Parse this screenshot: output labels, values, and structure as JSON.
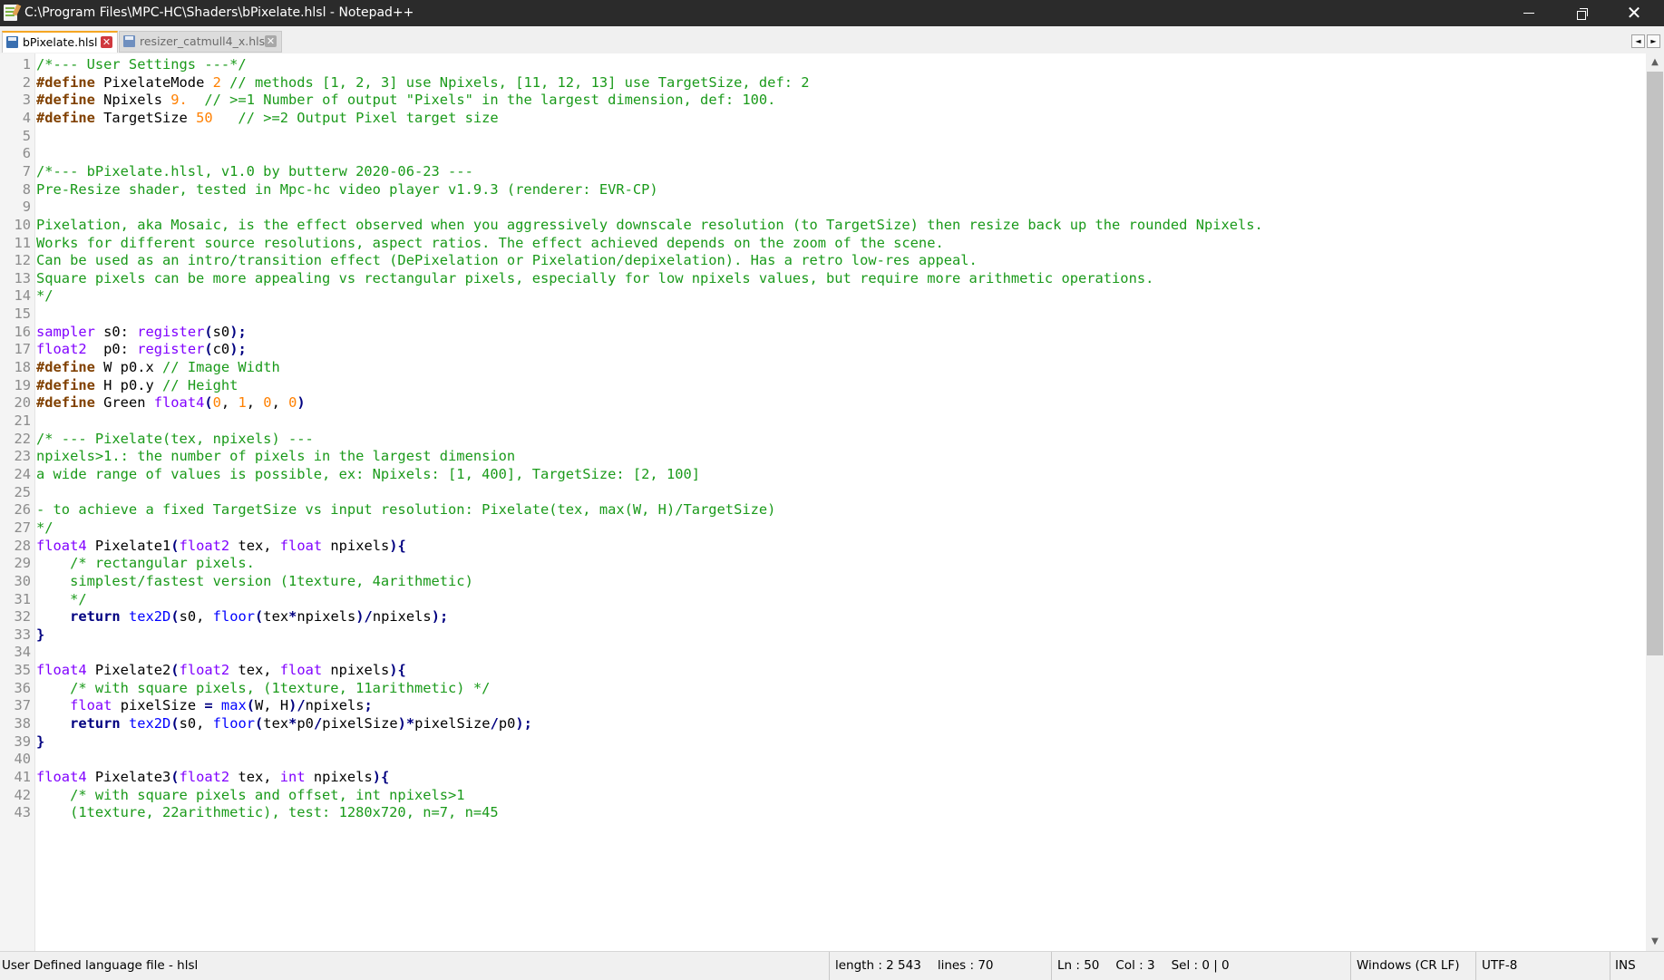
{
  "window": {
    "title": "C:\\Program Files\\MPC-HC\\Shaders\\bPixelate.hlsl - Notepad++",
    "controls": {
      "minimize_icon": "minimize-icon",
      "maximize_icon": "restore-icon",
      "close_icon": "close-icon"
    }
  },
  "tabs": [
    {
      "label": "bPixelate.hlsl",
      "active": true,
      "icon": "save-icon"
    },
    {
      "label": "resizer_catmull4_x.hlsl",
      "active": false,
      "icon": "save-icon"
    }
  ],
  "tab_scroll": {
    "left": "◄",
    "right": "►"
  },
  "colors": {
    "comment": "#1a9a1a",
    "preprocessor": "#804000",
    "number": "#ff8000",
    "type": "#8000ff",
    "keyword": "#000080",
    "function": "#0000ff",
    "active_tab_accent": "#f5a623",
    "titlebar": "#2b2b2b"
  },
  "editor": {
    "lines": [
      {
        "n": "1",
        "tokens": [
          [
            "cmt",
            "/*--- User Settings ---*/"
          ]
        ]
      },
      {
        "n": "2",
        "tokens": [
          [
            "pre",
            "#define"
          ],
          [
            "plain",
            " PixelateMode "
          ],
          [
            "num",
            "2"
          ],
          [
            "cmt",
            " // methods [1, 2, 3] use Npixels, [11, 12, 13] use TargetSize, def: 2"
          ]
        ]
      },
      {
        "n": "3",
        "tokens": [
          [
            "pre",
            "#define"
          ],
          [
            "plain",
            " Npixels "
          ],
          [
            "num",
            "9."
          ],
          [
            "cmt",
            "  // >=1 Number of output \"Pixels\" in the largest dimension, def: 100."
          ]
        ]
      },
      {
        "n": "4",
        "tokens": [
          [
            "pre",
            "#define"
          ],
          [
            "plain",
            " TargetSize "
          ],
          [
            "num",
            "50"
          ],
          [
            "cmt",
            "   // >=2 Output Pixel target size"
          ]
        ]
      },
      {
        "n": "5",
        "tokens": []
      },
      {
        "n": "6",
        "tokens": []
      },
      {
        "n": "7",
        "tokens": [
          [
            "cmt",
            "/*--- bPixelate.hlsl, v1.0 by butterw 2020-06-23 ---"
          ]
        ]
      },
      {
        "n": "8",
        "tokens": [
          [
            "cmt",
            "Pre-Resize shader, tested in Mpc-hc video player v1.9.3 (renderer: EVR-CP)"
          ]
        ]
      },
      {
        "n": "9",
        "tokens": []
      },
      {
        "n": "10",
        "tokens": [
          [
            "cmt",
            "Pixelation, aka Mosaic, is the effect observed when you aggressively downscale resolution (to TargetSize) then resize back up the rounded Npixels."
          ]
        ]
      },
      {
        "n": "11",
        "tokens": [
          [
            "cmt",
            "Works for different source resolutions, aspect ratios. The effect achieved depends on the zoom of the scene."
          ]
        ]
      },
      {
        "n": "12",
        "tokens": [
          [
            "cmt",
            "Can be used as an intro/transition effect (DePixelation or Pixelation/depixelation). Has a retro low-res appeal."
          ]
        ]
      },
      {
        "n": "13",
        "tokens": [
          [
            "cmt",
            "Square pixels can be more appealing vs rectangular pixels, especially for low npixels values, but require more arithmetic operations."
          ]
        ]
      },
      {
        "n": "14",
        "tokens": [
          [
            "cmt",
            "*/"
          ]
        ]
      },
      {
        "n": "15",
        "tokens": []
      },
      {
        "n": "16",
        "tokens": [
          [
            "type",
            "sampler"
          ],
          [
            "plain",
            " s0: "
          ],
          [
            "type",
            "register"
          ],
          [
            "op",
            "("
          ],
          [
            "plain",
            "s0"
          ],
          [
            "op",
            ");"
          ]
        ]
      },
      {
        "n": "17",
        "tokens": [
          [
            "type",
            "float2"
          ],
          [
            "plain",
            "  p0: "
          ],
          [
            "type",
            "register"
          ],
          [
            "op",
            "("
          ],
          [
            "plain",
            "c0"
          ],
          [
            "op",
            ");"
          ]
        ]
      },
      {
        "n": "18",
        "tokens": [
          [
            "pre",
            "#define"
          ],
          [
            "plain",
            " W p0.x "
          ],
          [
            "cmt",
            "// Image Width"
          ]
        ]
      },
      {
        "n": "19",
        "tokens": [
          [
            "pre",
            "#define"
          ],
          [
            "plain",
            " H p0.y "
          ],
          [
            "cmt",
            "// Height"
          ]
        ]
      },
      {
        "n": "20",
        "tokens": [
          [
            "pre",
            "#define"
          ],
          [
            "plain",
            " Green "
          ],
          [
            "type",
            "float4"
          ],
          [
            "op",
            "("
          ],
          [
            "num",
            "0"
          ],
          [
            "plain",
            ", "
          ],
          [
            "num",
            "1"
          ],
          [
            "plain",
            ", "
          ],
          [
            "num",
            "0"
          ],
          [
            "plain",
            ", "
          ],
          [
            "num",
            "0"
          ],
          [
            "op",
            ")"
          ]
        ]
      },
      {
        "n": "21",
        "tokens": []
      },
      {
        "n": "22",
        "tokens": [
          [
            "cmt",
            "/* --- Pixelate(tex, npixels) ---"
          ]
        ]
      },
      {
        "n": "23",
        "tokens": [
          [
            "cmt",
            "npixels>1.: the number of pixels in the largest dimension"
          ]
        ]
      },
      {
        "n": "24",
        "tokens": [
          [
            "cmt",
            "a wide range of values is possible, ex: Npixels: [1, 400], TargetSize: [2, 100]"
          ]
        ]
      },
      {
        "n": "25",
        "tokens": []
      },
      {
        "n": "26",
        "tokens": [
          [
            "cmt",
            "- to achieve a fixed TargetSize vs input resolution: Pixelate(tex, max(W, H)/TargetSize)"
          ]
        ]
      },
      {
        "n": "27",
        "tokens": [
          [
            "cmt",
            "*/"
          ]
        ]
      },
      {
        "n": "28",
        "tokens": [
          [
            "type",
            "float4"
          ],
          [
            "plain",
            " Pixelate1"
          ],
          [
            "op",
            "("
          ],
          [
            "type",
            "float2"
          ],
          [
            "plain",
            " tex, "
          ],
          [
            "type",
            "float"
          ],
          [
            "plain",
            " npixels"
          ],
          [
            "op",
            "){"
          ]
        ]
      },
      {
        "n": "29",
        "tokens": [
          [
            "cmt",
            "    /* rectangular pixels."
          ]
        ]
      },
      {
        "n": "30",
        "tokens": [
          [
            "cmt",
            "    simplest/fastest version (1texture, 4arithmetic)"
          ]
        ]
      },
      {
        "n": "31",
        "tokens": [
          [
            "cmt",
            "    */"
          ]
        ]
      },
      {
        "n": "32",
        "tokens": [
          [
            "plain",
            "    "
          ],
          [
            "kw",
            "return"
          ],
          [
            "plain",
            " "
          ],
          [
            "fn",
            "tex2D"
          ],
          [
            "op",
            "("
          ],
          [
            "plain",
            "s0, "
          ],
          [
            "fn",
            "floor"
          ],
          [
            "op",
            "("
          ],
          [
            "plain",
            "tex"
          ],
          [
            "op",
            "*"
          ],
          [
            "plain",
            "npixels"
          ],
          [
            "op",
            ")/"
          ],
          [
            "plain",
            "npixels"
          ],
          [
            "op",
            ");"
          ]
        ]
      },
      {
        "n": "33",
        "tokens": [
          [
            "op",
            "}"
          ]
        ]
      },
      {
        "n": "34",
        "tokens": []
      },
      {
        "n": "35",
        "tokens": [
          [
            "type",
            "float4"
          ],
          [
            "plain",
            " Pixelate2"
          ],
          [
            "op",
            "("
          ],
          [
            "type",
            "float2"
          ],
          [
            "plain",
            " tex, "
          ],
          [
            "type",
            "float"
          ],
          [
            "plain",
            " npixels"
          ],
          [
            "op",
            "){"
          ]
        ]
      },
      {
        "n": "36",
        "tokens": [
          [
            "cmt",
            "    /* with square pixels, (1texture, 11arithmetic) */"
          ]
        ]
      },
      {
        "n": "37",
        "tokens": [
          [
            "plain",
            "    "
          ],
          [
            "type",
            "float"
          ],
          [
            "plain",
            " pixelSize "
          ],
          [
            "op",
            "="
          ],
          [
            "plain",
            " "
          ],
          [
            "fn",
            "max"
          ],
          [
            "op",
            "("
          ],
          [
            "plain",
            "W, H"
          ],
          [
            "op",
            ")/"
          ],
          [
            "plain",
            "npixels"
          ],
          [
            "op",
            ";"
          ]
        ]
      },
      {
        "n": "38",
        "tokens": [
          [
            "plain",
            "    "
          ],
          [
            "kw",
            "return"
          ],
          [
            "plain",
            " "
          ],
          [
            "fn",
            "tex2D"
          ],
          [
            "op",
            "("
          ],
          [
            "plain",
            "s0, "
          ],
          [
            "fn",
            "floor"
          ],
          [
            "op",
            "("
          ],
          [
            "plain",
            "tex"
          ],
          [
            "op",
            "*"
          ],
          [
            "plain",
            "p0"
          ],
          [
            "op",
            "/"
          ],
          [
            "plain",
            "pixelSize"
          ],
          [
            "op",
            ")*"
          ],
          [
            "plain",
            "pixelSize"
          ],
          [
            "op",
            "/"
          ],
          [
            "plain",
            "p0"
          ],
          [
            "op",
            ");"
          ]
        ]
      },
      {
        "n": "39",
        "tokens": [
          [
            "op",
            "}"
          ]
        ]
      },
      {
        "n": "40",
        "tokens": []
      },
      {
        "n": "41",
        "tokens": [
          [
            "type",
            "float4"
          ],
          [
            "plain",
            " Pixelate3"
          ],
          [
            "op",
            "("
          ],
          [
            "type",
            "float2"
          ],
          [
            "plain",
            " tex, "
          ],
          [
            "type",
            "int"
          ],
          [
            "plain",
            " npixels"
          ],
          [
            "op",
            "){"
          ]
        ]
      },
      {
        "n": "42",
        "tokens": [
          [
            "cmt",
            "    /* with square pixels and offset, int npixels>1"
          ]
        ]
      },
      {
        "n": "43",
        "tokens": [
          [
            "cmt",
            "    (1texture, 22arithmetic), test: 1280x720, n=7, n=45"
          ]
        ]
      }
    ]
  },
  "scrollbar": {
    "up_icon": "▲",
    "down_icon": "▼",
    "position_fraction": 0.0
  },
  "statusbar": {
    "language": "User Defined language file - hlsl",
    "length": "length : 2 543",
    "lines": "lines : 70",
    "ln": "Ln : 50",
    "col": "Col : 3",
    "sel": "Sel : 0 | 0",
    "eol": "Windows (CR LF)",
    "encoding": "UTF-8",
    "mode": "INS"
  }
}
